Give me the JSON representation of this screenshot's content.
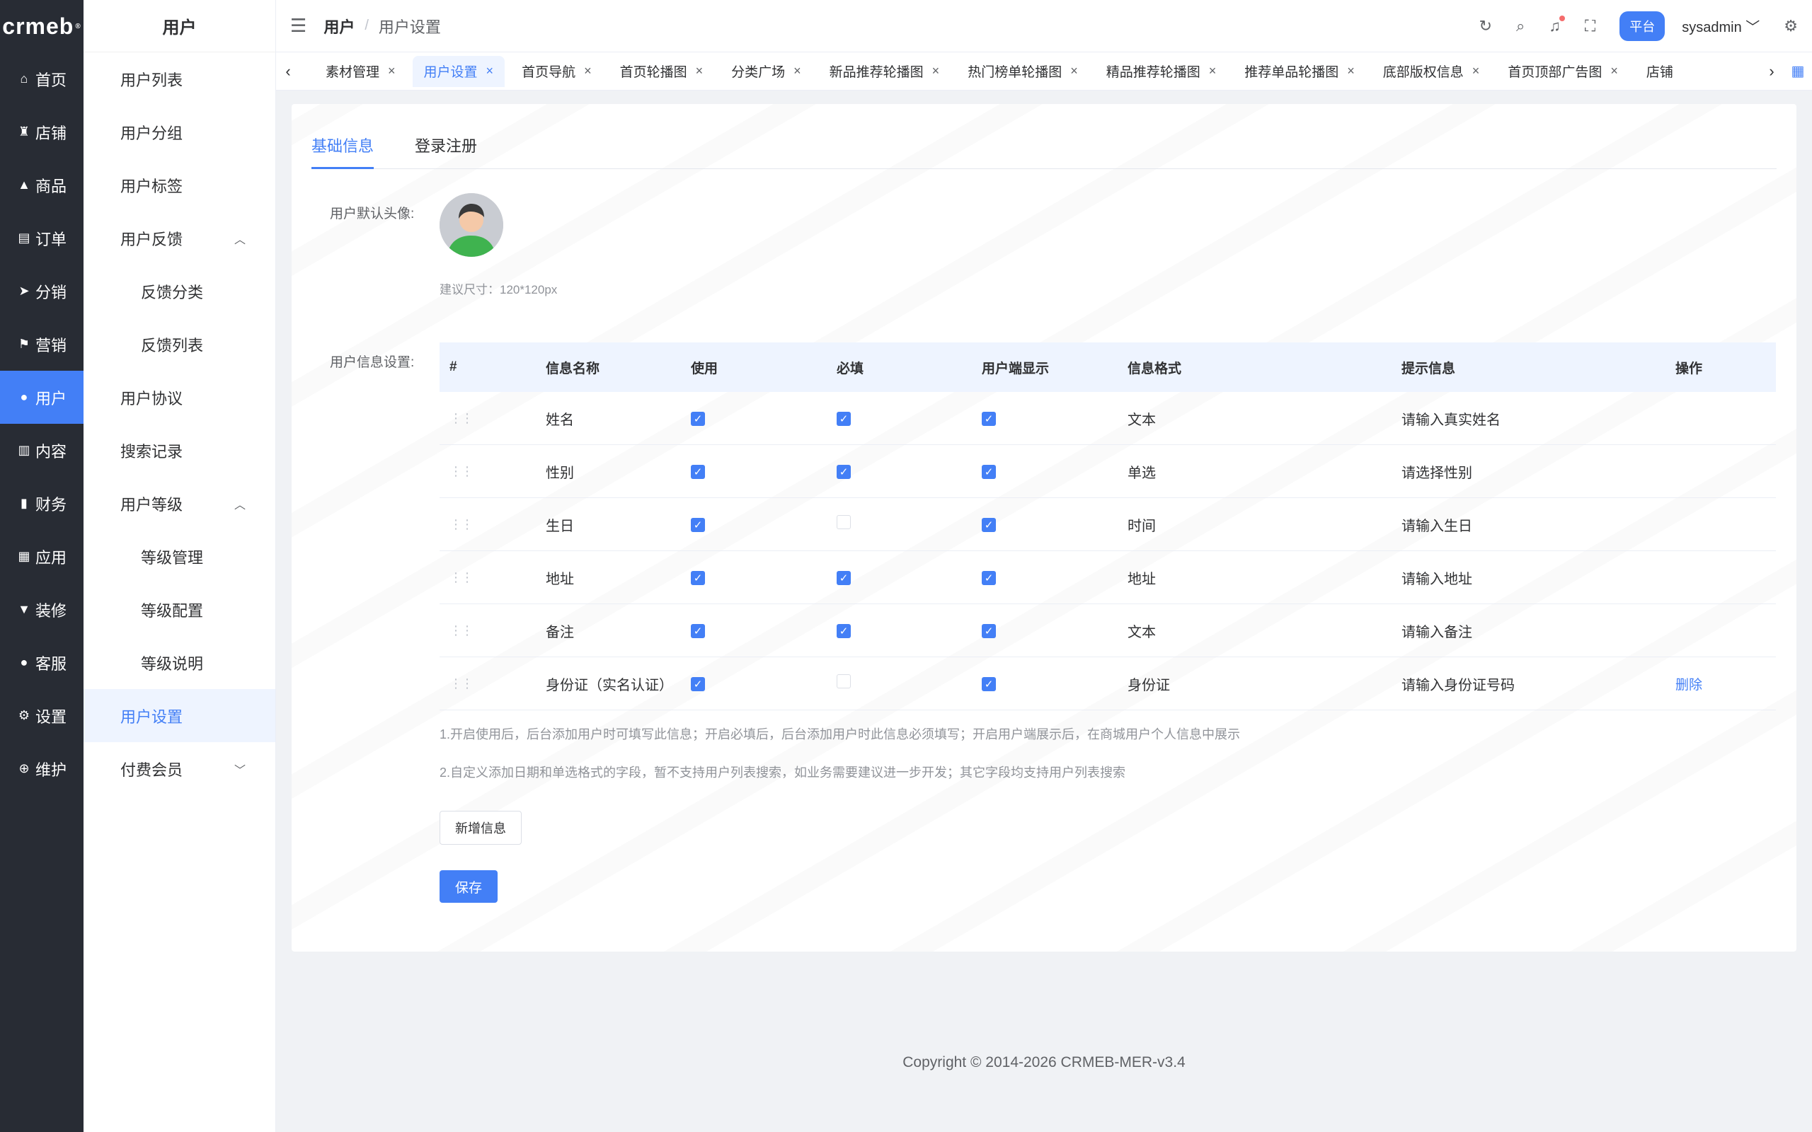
{
  "rail": {
    "logo": "crmeb",
    "items": [
      {
        "label": "首页",
        "icon": "⌂"
      },
      {
        "label": "店铺",
        "icon": "♜"
      },
      {
        "label": "商品",
        "icon": "▲"
      },
      {
        "label": "订单",
        "icon": "▤"
      },
      {
        "label": "分销",
        "icon": "➤"
      },
      {
        "label": "营销",
        "icon": "⚑"
      },
      {
        "label": "用户",
        "icon": "●"
      },
      {
        "label": "内容",
        "icon": "▥"
      },
      {
        "label": "财务",
        "icon": "▮"
      },
      {
        "label": "应用",
        "icon": "▦"
      },
      {
        "label": "装修",
        "icon": "▼"
      },
      {
        "label": "客服",
        "icon": "●"
      },
      {
        "label": "设置",
        "icon": "⚙"
      },
      {
        "label": "维护",
        "icon": "⊕"
      }
    ]
  },
  "sidebar": {
    "title": "用户",
    "items": [
      {
        "label": "用户列表"
      },
      {
        "label": "用户分组"
      },
      {
        "label": "用户标签"
      },
      {
        "label": "用户反馈",
        "chevron": "︿"
      },
      {
        "label": "反馈分类"
      },
      {
        "label": "反馈列表"
      },
      {
        "label": "用户协议"
      },
      {
        "label": "搜索记录"
      },
      {
        "label": "用户等级",
        "chevron": "︿"
      },
      {
        "label": "等级管理"
      },
      {
        "label": "等级配置"
      },
      {
        "label": "等级说明"
      },
      {
        "label": "用户设置"
      },
      {
        "label": "付费会员",
        "chevron": "﹀"
      }
    ]
  },
  "header": {
    "menu_icon": "☰",
    "breadcrumb_parent": "用户",
    "breadcrumb_sep": "/",
    "breadcrumb_current": "用户设置",
    "refresh_icon": "↻",
    "search_icon": "⌕",
    "bell_icon": "♫",
    "fullscreen_icon": "⛶",
    "platform_badge": "平台",
    "username": "sysadmin",
    "user_chevron": "﹀",
    "gear_icon": "⚙"
  },
  "tabs": {
    "left_arrow": "‹",
    "right_arrow": "›",
    "grid_icon": "▦",
    "close": "×",
    "items": [
      {
        "label": "素材管理"
      },
      {
        "label": "用户设置"
      },
      {
        "label": "首页导航"
      },
      {
        "label": "首页轮播图"
      },
      {
        "label": "分类广场"
      },
      {
        "label": "新品推荐轮播图"
      },
      {
        "label": "热门榜单轮播图"
      },
      {
        "label": "精品推荐轮播图"
      },
      {
        "label": "推荐单品轮播图"
      },
      {
        "label": "底部版权信息"
      },
      {
        "label": "首页顶部广告图"
      },
      {
        "label": "店铺"
      }
    ]
  },
  "content": {
    "tab_basic": "基础信息",
    "tab_login": "登录注册",
    "avatar_label": "用户默认头像:",
    "avatar_hint": "建议尺寸：120*120px",
    "info_label": "用户信息设置:",
    "columns": [
      "#",
      "信息名称",
      "使用",
      "必填",
      "用户端显示",
      "信息格式",
      "提示信息",
      "操作"
    ],
    "drag_handle": "⋮⋮",
    "check_mark": "✓",
    "rows": [
      {
        "name": "姓名",
        "use": true,
        "required": true,
        "show": true,
        "format": "文本",
        "hint": "请输入真实姓名",
        "action": ""
      },
      {
        "name": "性别",
        "use": true,
        "required": true,
        "show": true,
        "format": "单选",
        "hint": "请选择性别",
        "action": ""
      },
      {
        "name": "生日",
        "use": true,
        "required": false,
        "show": true,
        "format": "时间",
        "hint": "请输入生日",
        "action": ""
      },
      {
        "name": "地址",
        "use": true,
        "required": true,
        "show": true,
        "format": "地址",
        "hint": "请输入地址",
        "action": ""
      },
      {
        "name": "备注",
        "use": true,
        "required": true,
        "show": true,
        "format": "文本",
        "hint": "请输入备注",
        "action": ""
      },
      {
        "name": "身份证（实名认证）",
        "use": true,
        "required": false,
        "show": true,
        "format": "身份证",
        "hint": "请输入身份证号码",
        "action": "删除"
      }
    ],
    "note1": "1.开启使用后，后台添加用户时可填写此信息；开启必填后，后台添加用户时此信息必须填写；开启用户端展示后，在商城用户个人信息中展示",
    "note2": "2.自定义添加日期和单选格式的字段，暂不支持用户列表搜索，如业务需要建议进一步开发；其它字段均支持用户列表搜索",
    "add_button": "新增信息",
    "save_button": "保存"
  },
  "footer": {
    "copyright": "Copyright © 2014-2026 CRMEB-MER-v3.4"
  },
  "colors": {
    "accent": "#437ff6",
    "rail_bg": "#282c34"
  }
}
